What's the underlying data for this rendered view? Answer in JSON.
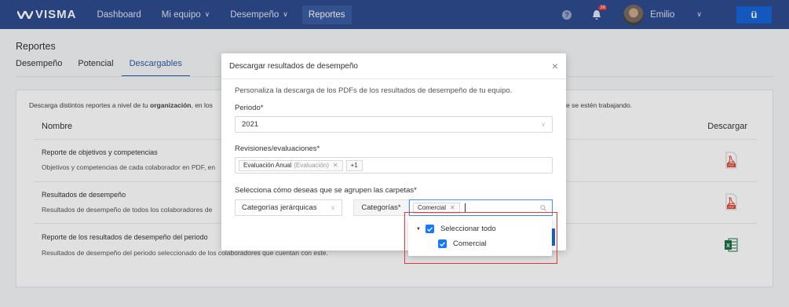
{
  "nav": {
    "logo": "VISMA",
    "items": [
      {
        "label": "Dashboard",
        "has_chevron": false,
        "active": false
      },
      {
        "label": "Mi equipo",
        "has_chevron": true,
        "active": false
      },
      {
        "label": "Desempeño",
        "has_chevron": true,
        "active": false
      },
      {
        "label": "Reportes",
        "has_chevron": false,
        "active": true
      }
    ],
    "help_icon": "?",
    "notification_count": "36",
    "user_name": "Emilio",
    "app_button": "ü",
    "chevron": "∨",
    "colors": {
      "bar": "#2d4c8f",
      "app_button": "#1565d8"
    }
  },
  "page": {
    "title": "Reportes",
    "tabs": [
      "Desempeño",
      "Potencial",
      "Descargables"
    ],
    "active_tab": "Descargables",
    "description_prefix": "Descarga distintos reportes a nivel de tu ",
    "description_bold": "organización",
    "description_mid": ", en los",
    "description_end": "e se estén trabajando.",
    "table": {
      "col_name": "Nombre",
      "col_download": "Descargar",
      "rows": [
        {
          "title": "Reporte de objetivos y competencias",
          "subtitle": "Objetivos y competencias de cada colaborador en PDF, en",
          "file_type": "pdf"
        },
        {
          "title": "Resultados de desempeño",
          "subtitle": "Resultados de desempeño de todos los colaboradores de",
          "file_type": "pdf"
        },
        {
          "title": "Reporte de los resultados de desempeño del periodo",
          "subtitle": "Resultados de desempeño del periodo seleccionado de los colaboradores que cuentan con este.",
          "file_type": "xls"
        }
      ]
    }
  },
  "modal": {
    "title": "Descargar resultados de desempeño",
    "close": "×",
    "intro": "Personaliza la descarga de los PDFs de los resultados de desempeño de tu equipo.",
    "period_label": "Periodo*",
    "period_value": "2021",
    "reviews_label": "Revisiones/evaluaciones*",
    "review_tag": "Evaluación Anual",
    "review_tag_type": "(Evaluación)",
    "review_more": "+1",
    "group_label": "Selecciona cómo deseas que se agrupen las carpetas*",
    "group_value": "Categorías jerárquicas",
    "categories_label": "Categorías*",
    "category_tag": "Comercial"
  },
  "dropdown": {
    "select_all": "Seleccionar todo",
    "select_all_checked": true,
    "items": [
      {
        "label": "Comercial",
        "checked": true
      }
    ]
  }
}
